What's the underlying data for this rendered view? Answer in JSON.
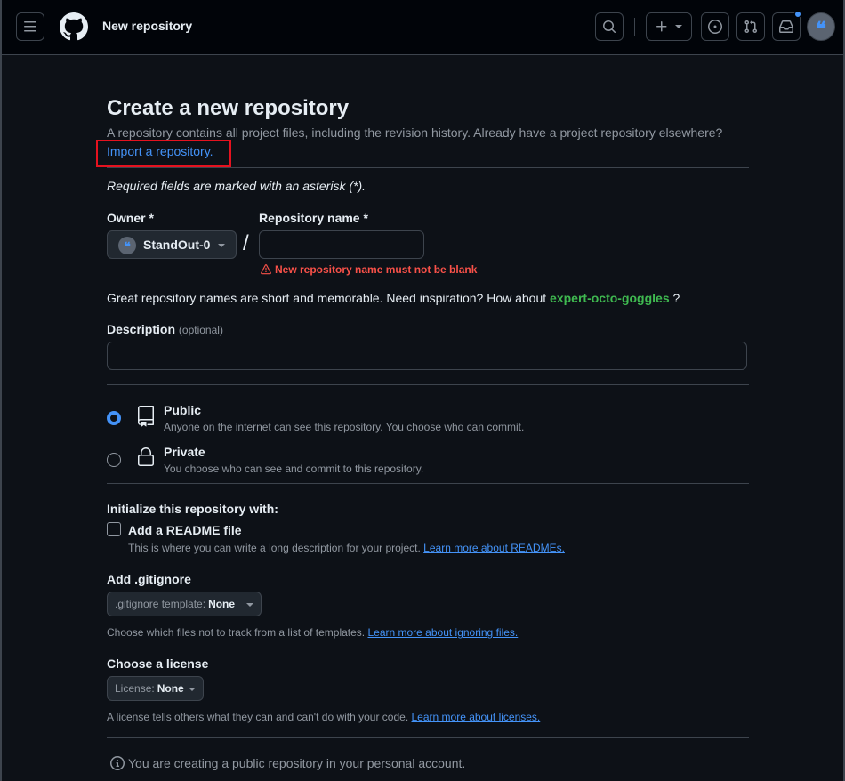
{
  "header": {
    "page_context": "New repository"
  },
  "page": {
    "title": "Create a new repository",
    "subtitle": "A repository contains all project files, including the revision history. Already have a project repository elsewhere?",
    "import_link": "Import a repository.",
    "required_note": "Required fields are marked with an asterisk (*)."
  },
  "owner": {
    "label": "Owner *",
    "value": "StandOut-0"
  },
  "repo_name": {
    "label": "Repository name *",
    "value": "",
    "error": "New repository name must not be blank"
  },
  "inspiration": {
    "text": "Great repository names are short and memorable. Need inspiration? How about",
    "suggestion": "expert-octo-goggles",
    "suffix": "?"
  },
  "description": {
    "label": "Description",
    "optional": "(optional)",
    "value": ""
  },
  "visibility": {
    "public_title": "Public",
    "public_desc": "Anyone on the internet can see this repository. You choose who can commit.",
    "private_title": "Private",
    "private_desc": "You choose who can see and commit to this repository.",
    "selected": "public"
  },
  "init": {
    "heading": "Initialize this repository with:",
    "readme_label": "Add a README file",
    "readme_desc": "This is where you can write a long description for your project.",
    "readme_link": "Learn more about READMEs."
  },
  "gitignore": {
    "heading": "Add .gitignore",
    "select_prefix": ".gitignore template:",
    "select_value": "None",
    "desc": "Choose which files not to track from a list of templates.",
    "link": "Learn more about ignoring files."
  },
  "license": {
    "heading": "Choose a license",
    "select_prefix": "License:",
    "select_value": "None",
    "desc": "A license tells others what they can and can't do with your code.",
    "link": "Learn more about licenses."
  },
  "info": {
    "text": "You are creating a public repository in your personal account."
  },
  "colors": {
    "background": "#0d1117",
    "header_bg": "#010409",
    "accent": "#4493f8",
    "success": "#3fb950",
    "danger": "#f85149",
    "highlight_box": "#e5121f"
  },
  "icons": [
    "menu-icon",
    "github-logo-icon",
    "search-icon",
    "plus-icon",
    "issues-icon",
    "pull-requests-icon",
    "inbox-icon",
    "repo-icon",
    "lock-icon",
    "alert-icon",
    "info-icon"
  ]
}
